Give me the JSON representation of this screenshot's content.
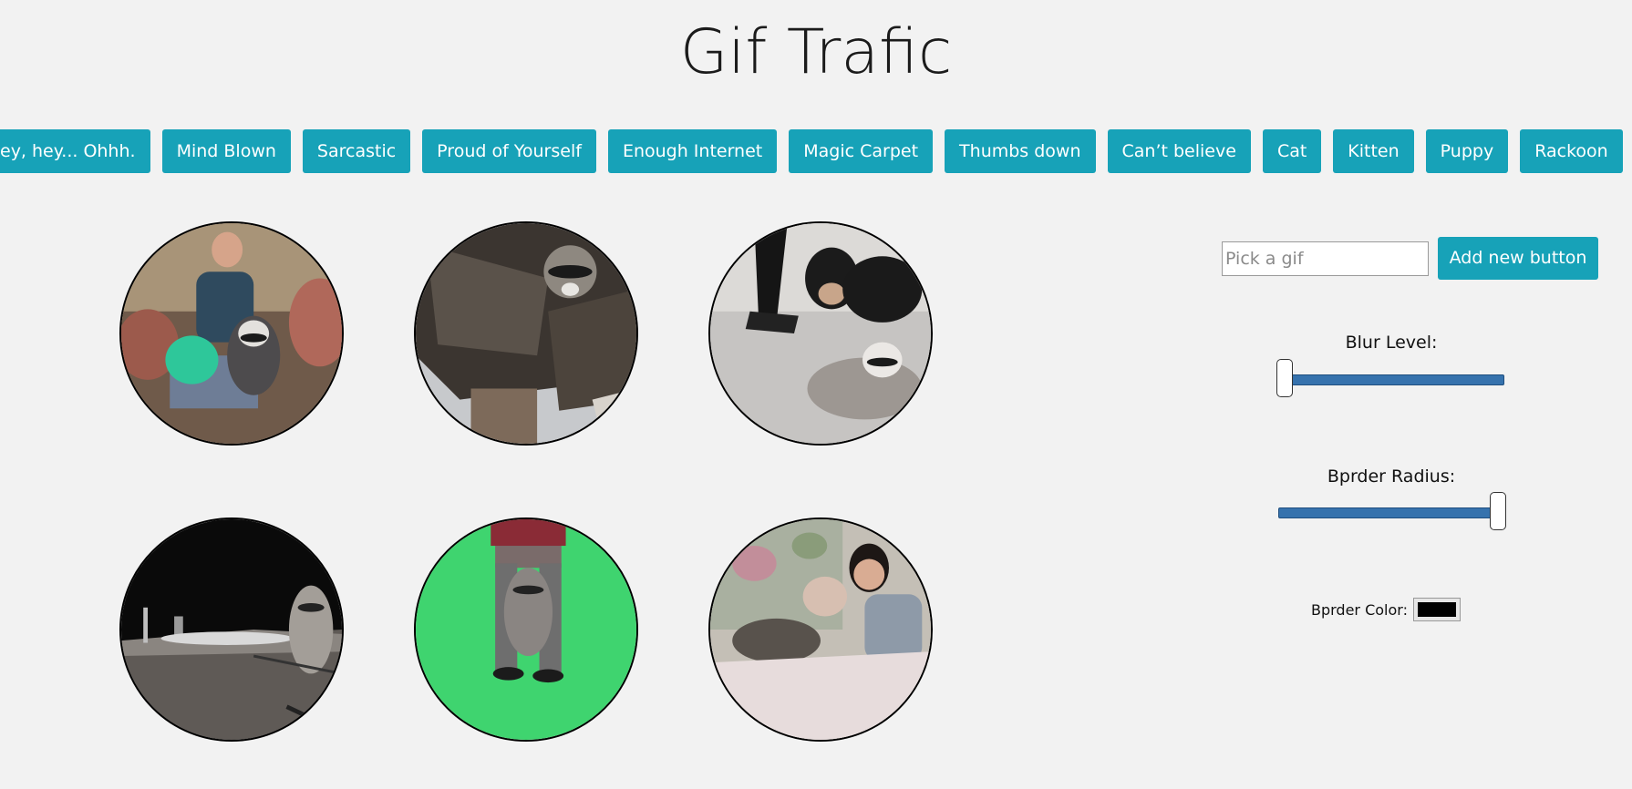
{
  "header": {
    "title": "Gif Trafic"
  },
  "topic_buttons": [
    "ey, hey... Ohhh.",
    "Mind Blown",
    "Sarcastic",
    "Proud of Yourself",
    "Enough Internet",
    "Magic Carpet",
    "Thumbs down",
    "Can’t believe",
    "Cat",
    "Kitten",
    "Puppy",
    "Rackoon"
  ],
  "controls": {
    "search_placeholder": "Pick a gif",
    "add_button_label": "Add new button",
    "blur_label": "Blur Level:",
    "blur_value": 0,
    "radius_label": "Bprder Radius:",
    "radius_value": 1,
    "color_label": "Bprder Color:",
    "border_color": "#000000"
  },
  "colors": {
    "accent": "#17a2b8",
    "background": "#f2f2f2",
    "slider_track": "#3672ad"
  }
}
